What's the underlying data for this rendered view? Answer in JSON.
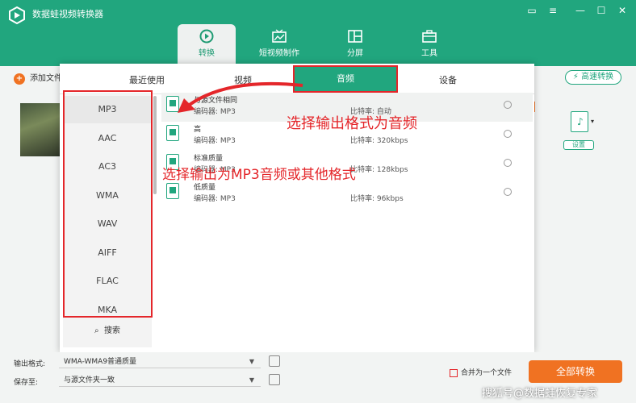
{
  "app": {
    "title": "数据蛙视频转换器",
    "watermark": "搜狐号@数据蛙恢复专家"
  },
  "window_controls": [
    {
      "name": "message-icon",
      "glyph": "▭"
    },
    {
      "name": "menu-icon",
      "glyph": "≡"
    },
    {
      "name": "minimize-icon",
      "glyph": "—"
    },
    {
      "name": "maximize-icon",
      "glyph": "☐"
    },
    {
      "name": "close-icon",
      "glyph": "✕"
    }
  ],
  "nav": [
    {
      "label": "转换",
      "active": true
    },
    {
      "label": "短视频制作",
      "active": false
    },
    {
      "label": "分屏",
      "active": false
    },
    {
      "label": "工具",
      "active": false
    }
  ],
  "main": {
    "add_file": "添加文件",
    "fast_convert": "高速转换",
    "settings": "设置"
  },
  "popup": {
    "tabs": [
      "最近使用",
      "视频",
      "音频",
      "设备"
    ],
    "active_tab": "音频",
    "formats": [
      "MP3",
      "AAC",
      "AC3",
      "WMA",
      "WAV",
      "AIFF",
      "FLAC",
      "MKA"
    ],
    "selected_format": "MP3",
    "search": "搜索",
    "qualities": [
      {
        "name": "与源文件相同",
        "encoder": "编码器:  MP3",
        "bitrate": "比特率:  自动"
      },
      {
        "name": "高",
        "encoder": "编码器:  MP3",
        "bitrate": "比特率:   320kbps"
      },
      {
        "name": "标准质量",
        "encoder": "编码器:  MP3",
        "bitrate": "比特率:   128kbps"
      },
      {
        "name": "低质量",
        "encoder": "编码器:  MP3",
        "bitrate": "比特率:   96kbps"
      }
    ]
  },
  "annotations": {
    "a1": "选择输出格式为音频",
    "a2": "选择输出为MP3音频或其他格式"
  },
  "bottom": {
    "output_label": "输出格式:",
    "output_value": "WMA-WMA9普通质量",
    "save_label": "保存至:",
    "save_value": "与源文件夹一致",
    "merge": "合并为一个文件",
    "convert_all": "全部转换"
  },
  "colors": {
    "accent": "#21a67e",
    "orange": "#f07222",
    "annotation_red": "#e4262a"
  }
}
